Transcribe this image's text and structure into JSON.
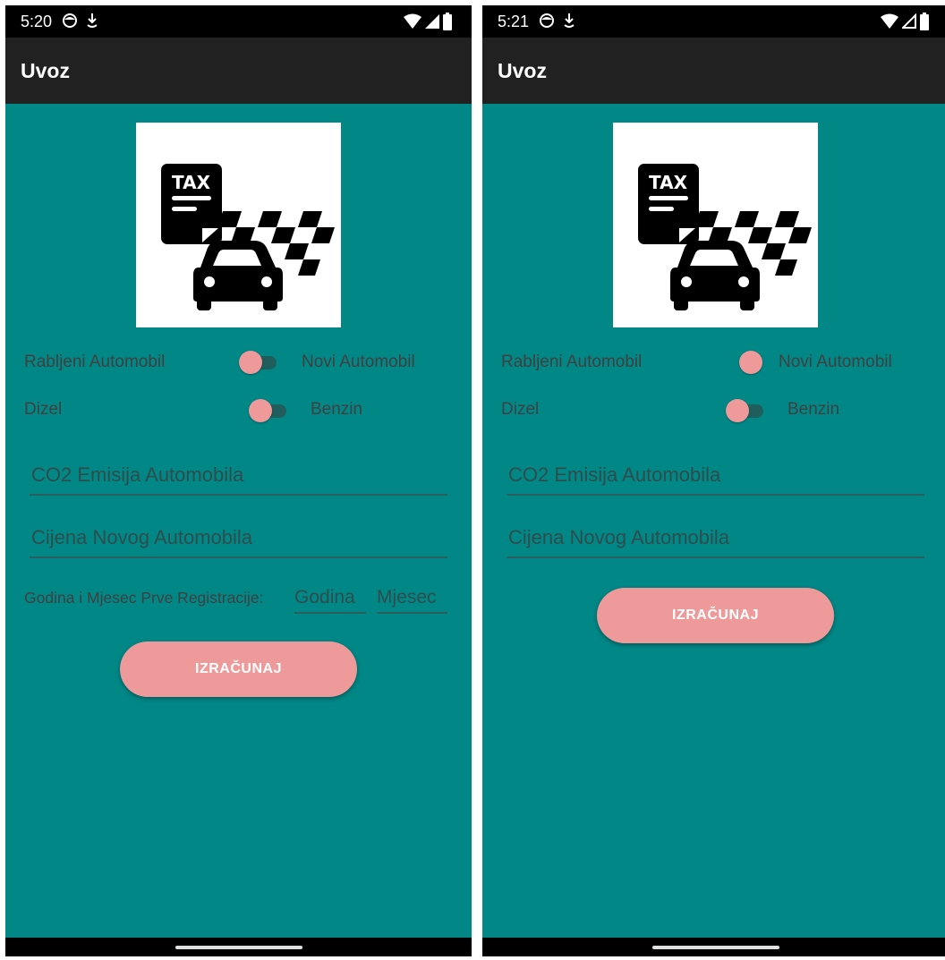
{
  "left": {
    "time": "5:20",
    "app_title": "Uvoz",
    "logo_text": "TAX",
    "toggle1_left": "Rabljeni Automobil",
    "toggle1_right": "Novi Automobil",
    "toggle2_left": "Dizel",
    "toggle2_right": "Benzin",
    "co2_hint": "CO2 Emisija Automobila",
    "price_hint": "Cijena Novog Automobila",
    "registration_label": "Godina i Mjesec Prve Registracije:",
    "year_hint": "Godina",
    "month_hint": "Mjesec",
    "button_label": "IZRAČUNAJ"
  },
  "right": {
    "time": "5:21",
    "app_title": "Uvoz",
    "logo_text": "TAX",
    "toggle1_left": "Rabljeni Automobil",
    "toggle1_right": "Novi Automobil",
    "toggle2_left": "Dizel",
    "toggle2_right": "Benzin",
    "co2_hint": "CO2 Emisija Automobila",
    "price_hint": "Cijena Novog Automobila",
    "button_label": "IZRAČUNAJ"
  },
  "colors": {
    "background": "#018786",
    "appbar": "#212121",
    "accent": "#ef9a9a",
    "status_bar": "#000000"
  },
  "icons": [
    "face-status-icon",
    "download-status-icon",
    "wifi-icon",
    "cell-signal-icon",
    "battery-icon",
    "tax-car-logo-icon"
  ]
}
